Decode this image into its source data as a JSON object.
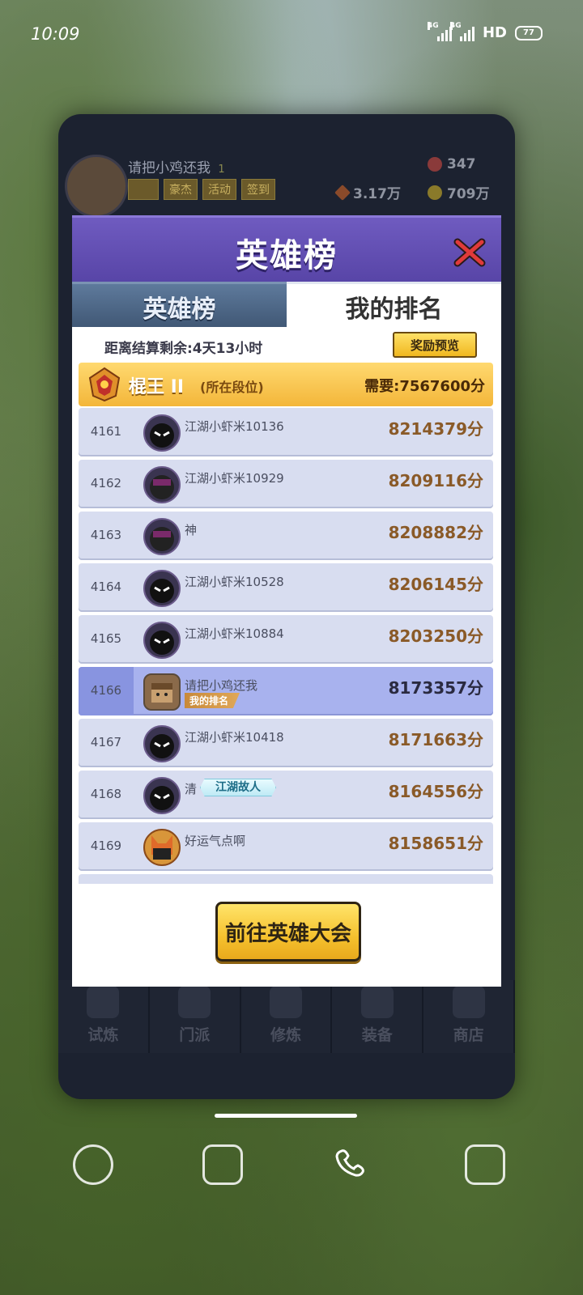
{
  "status_bar": {
    "time": "10:09",
    "network1": "4G",
    "network2": "4G",
    "hd": "HD",
    "battery": "77"
  },
  "game": {
    "player_name": "请把小鸡还我",
    "player_level": "1",
    "top_buttons": [
      "豪杰",
      "活动",
      "签到"
    ],
    "gems": "347",
    "power": "3.17万",
    "coins": "709万",
    "nav": [
      "试炼",
      "门派",
      "修炼",
      "装备",
      "商店"
    ]
  },
  "modal": {
    "title": "英雄榜",
    "tabs": [
      "英雄榜",
      "我的排名"
    ],
    "countdown": "距离结算剩余:4天13小时",
    "reward_preview": "奖励预览",
    "tier": {
      "name": "棍王 II",
      "note": "(所在段位)",
      "need": "需要:7567600分"
    },
    "rows": [
      {
        "rank": "4161",
        "name": "江湖小虾米10136",
        "score": "8214379分"
      },
      {
        "rank": "4162",
        "name": "江湖小虾米10929",
        "score": "8209116分"
      },
      {
        "rank": "4163",
        "name": "神",
        "score": "8208882分"
      },
      {
        "rank": "4164",
        "name": "江湖小虾米10528",
        "score": "8206145分"
      },
      {
        "rank": "4165",
        "name": "江湖小虾米10884",
        "score": "8203250分"
      },
      {
        "rank": "4166",
        "name": "请把小鸡还我",
        "score": "8173357分",
        "tag": "我的排名"
      },
      {
        "rank": "4167",
        "name": "江湖小虾米10418",
        "score": "8171663分"
      },
      {
        "rank": "4168",
        "name": "清",
        "score": "8164556分",
        "badge": "江湖故人"
      },
      {
        "rank": "4169",
        "name": "好运气点啊",
        "score": "8158651分"
      }
    ],
    "go_button": "前往英雄大会"
  }
}
